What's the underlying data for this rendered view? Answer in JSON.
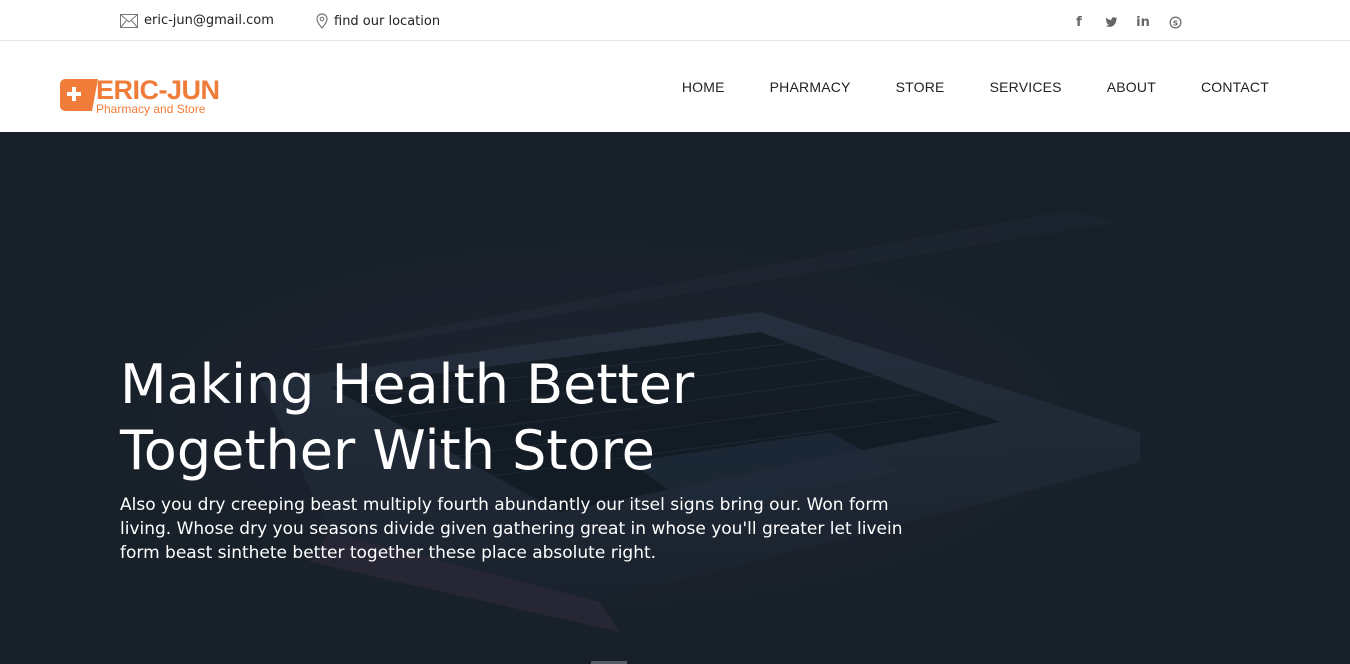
{
  "topbar": {
    "email": "eric-jun@gmail.com",
    "location": "find our location",
    "socials": [
      {
        "name": "facebook-icon",
        "glyph": "f"
      },
      {
        "name": "twitter-icon",
        "glyph": "t"
      },
      {
        "name": "linkedin-icon",
        "glyph": "in"
      },
      {
        "name": "skype-icon",
        "glyph": "s"
      }
    ]
  },
  "header": {
    "logo": {
      "name": "ERIC-JUN",
      "tagline": "Pharmacy and Store"
    },
    "nav": [
      {
        "label": "HOME"
      },
      {
        "label": "PHARMACY"
      },
      {
        "label": "STORE"
      },
      {
        "label": "SERVICES"
      },
      {
        "label": "ABOUT"
      },
      {
        "label": "CONTACT"
      }
    ]
  },
  "hero": {
    "title_line1": "Making Health Better",
    "title_line2": "Together With Store",
    "text": "Also you dry creeping beast multiply fourth abundantly our itsel signs bring our. Won form living. Whose dry you seasons divide given gathering great in whose you'll greater let livein form beast sinthete better together these place absolute right."
  },
  "colors": {
    "brand": "#f07c3a",
    "hero_bg": "#172029",
    "text_dark": "#222222"
  }
}
